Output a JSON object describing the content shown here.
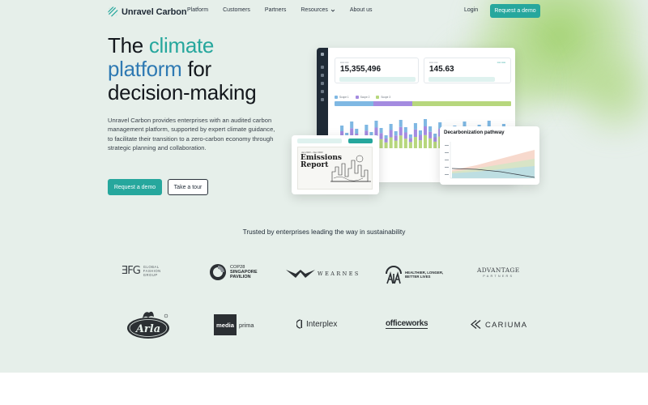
{
  "brand": {
    "name": "Unravel Carbon",
    "accent": "#26a79d",
    "accent_blue": "#2f7ab3",
    "background": "#e6efea",
    "logo_icon": "striped-circle-icon"
  },
  "nav": {
    "items": [
      "Platform",
      "Customers",
      "Partners",
      "Resources",
      "About us"
    ],
    "dropdown_icon": "chevron-down-icon",
    "login": "Login",
    "cta": "Request a demo"
  },
  "hero": {
    "title_pre": "The ",
    "title_hl1": "climate",
    "title_hl2": "platform",
    "title_mid": " for",
    "title_end": "decision-making",
    "description": "Unravel Carbon provides enterprises with an audited carbon management platform, supported by expert climate guidance, to facilitate their transition to a zero-carbon economy through strategic planning and collaboration.",
    "primary_button": "Request a demo",
    "secondary_button": "Take a tour"
  },
  "dashboard": {
    "kpi1": {
      "value": "15,355,496"
    },
    "kpi2": {
      "value": "145.63"
    },
    "legend": [
      "Scope 1",
      "Scope 2",
      "Scope 3"
    ],
    "legend_colors": [
      "#7fb8e3",
      "#a48be0",
      "#b7d77d"
    ],
    "scope_share": [
      0.22,
      0.22,
      0.56
    ]
  },
  "report_card": {
    "date": "Jan 2023 – Dec 2023",
    "title": "Emissions Report"
  },
  "decarb_card": {
    "title": "Decarbonization pathway"
  },
  "trusted": {
    "heading": "Trusted by enterprises leading the way in sustainability",
    "logos": {
      "gfg": {
        "mark": "ƎFG",
        "text_lines": [
          "GLOBAL",
          "FASHION",
          "GROUP"
        ]
      },
      "cop": {
        "line1": "COP28",
        "line2": "SINGAPORE",
        "line3": "PAVILION"
      },
      "wearnes": {
        "text": "WEARNES"
      },
      "aia": {
        "mark": "AIA",
        "line1": "HEALTHIER, LONGER,",
        "line2": "BETTER LIVES"
      },
      "advantage": {
        "line1": "ADVANTAGE",
        "line2": "PARTNERS"
      },
      "arla": {
        "text": "Arla"
      },
      "media": {
        "box": "media",
        "text": "prima"
      },
      "interplex": {
        "text": "Interplex"
      },
      "officeworks": {
        "text": "officeworks"
      },
      "cariuma": {
        "text": "CARIUMA"
      }
    }
  }
}
